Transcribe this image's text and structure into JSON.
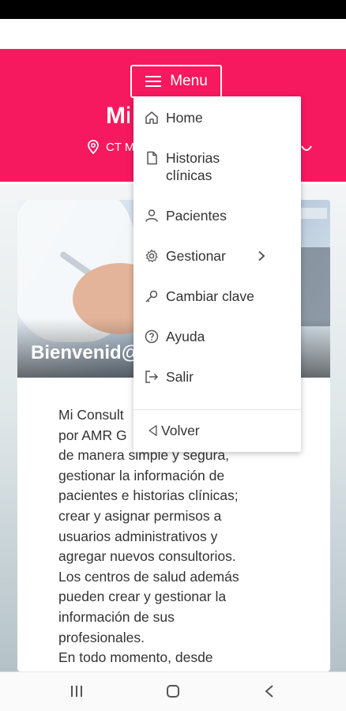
{
  "header": {
    "menu_label": "Menu",
    "title_visible": "Mi",
    "location_visible": "CT M"
  },
  "dropdown": {
    "items": [
      {
        "label": "Home",
        "icon": "home-icon"
      },
      {
        "label": "Historias clínicas",
        "icon": "document-icon"
      },
      {
        "label": "Pacientes",
        "icon": "user-icon"
      },
      {
        "label": "Gestionar",
        "icon": "gear-icon"
      },
      {
        "label": "Cambiar clave",
        "icon": "key-icon"
      },
      {
        "label": "Ayuda",
        "icon": "help-circle-icon"
      },
      {
        "label": "Salir",
        "icon": "logout-icon"
      }
    ],
    "back_label": "Volver"
  },
  "card": {
    "welcome_visible": "Bienvenid@",
    "intro_lines": [
      "Mi Consult",
      "por AMR G",
      "de manera simple y segura,",
      "gestionar la información de",
      "pacientes e historias clínicas;",
      "crear y asignar permisos a",
      "usuarios administrativos y",
      "agregar nuevos consultorios.",
      "Los centros de salud además",
      "pueden crear y gestionar la",
      "información de sus",
      "profesionales.",
      "En todo momento, desde"
    ]
  },
  "colors": {
    "brand": "#f7195f"
  }
}
